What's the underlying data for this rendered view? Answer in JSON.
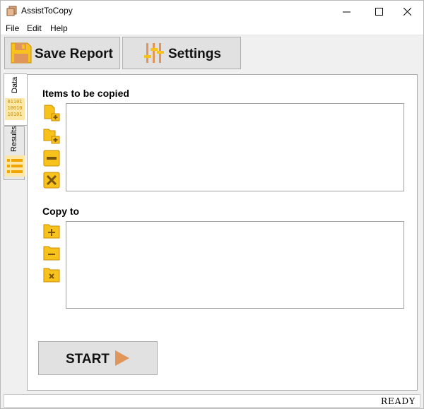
{
  "window": {
    "title": "AssistToCopy"
  },
  "menu": {
    "file": "File",
    "edit": "Edit",
    "help": "Help"
  },
  "toolbar": {
    "save_report": "Save Report",
    "settings": "Settings"
  },
  "tabs": {
    "data": "Data",
    "results": "Results",
    "data_icon_lines": [
      "01101",
      "10010",
      "10101"
    ]
  },
  "items_section": {
    "title": "Items to be copied"
  },
  "copyto_section": {
    "title": "Copy to"
  },
  "start_button": {
    "label": "START"
  },
  "status": {
    "text": "READY"
  },
  "colors": {
    "icon_yellow": "#f7c21b",
    "icon_dark": "#7a5410",
    "accent_orange": "#e0955a",
    "tab_icon_bg": "#fde7a6"
  }
}
